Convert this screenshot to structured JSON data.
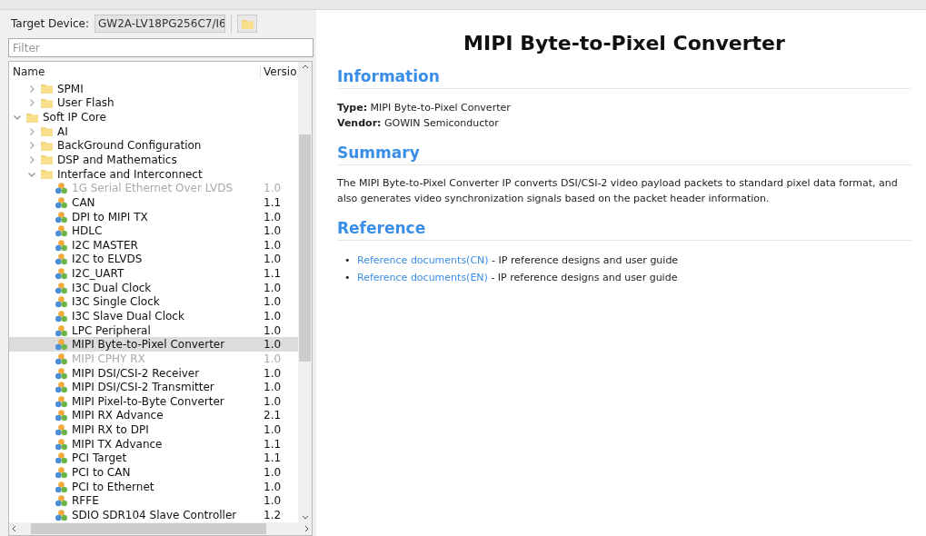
{
  "toolbar": {
    "label": "Target Device:",
    "device": "GW2A-LV18PG256C7/I6"
  },
  "filter": {
    "placeholder": "Filter"
  },
  "tree": {
    "columns": [
      "Name",
      "Versio"
    ],
    "scrolled_group": [
      {
        "kind": "folder",
        "label": "SPMI",
        "expanded": false
      },
      {
        "kind": "folder",
        "label": "User Flash",
        "expanded": false
      }
    ],
    "items": [
      {
        "kind": "folder",
        "label": "Soft IP Core",
        "expanded": true,
        "children": [
          {
            "kind": "folder",
            "label": "AI",
            "expanded": false
          },
          {
            "kind": "folder",
            "label": "BackGround Configuration",
            "expanded": false
          },
          {
            "kind": "folder",
            "label": "DSP and Mathematics",
            "expanded": false
          },
          {
            "kind": "folder",
            "label": "Interface and Interconnect",
            "expanded": true,
            "children": [
              {
                "kind": "ip",
                "label": "1G Serial Ethernet Over LVDS",
                "version": "1.0",
                "disabled": true,
                "selected": false
              },
              {
                "kind": "ip",
                "label": "CAN",
                "version": "1.1",
                "disabled": false,
                "selected": false
              },
              {
                "kind": "ip",
                "label": "DPI to MIPI TX",
                "version": "1.0",
                "disabled": false,
                "selected": false
              },
              {
                "kind": "ip",
                "label": "HDLC",
                "version": "1.0",
                "disabled": false,
                "selected": false
              },
              {
                "kind": "ip",
                "label": "I2C MASTER",
                "version": "1.0",
                "disabled": false,
                "selected": false
              },
              {
                "kind": "ip",
                "label": "I2C to ELVDS",
                "version": "1.0",
                "disabled": false,
                "selected": false
              },
              {
                "kind": "ip",
                "label": "I2C_UART",
                "version": "1.1",
                "disabled": false,
                "selected": false
              },
              {
                "kind": "ip",
                "label": "I3C Dual Clock",
                "version": "1.0",
                "disabled": false,
                "selected": false
              },
              {
                "kind": "ip",
                "label": "I3C Single Clock",
                "version": "1.0",
                "disabled": false,
                "selected": false
              },
              {
                "kind": "ip",
                "label": "I3C Slave Dual Clock",
                "version": "1.0",
                "disabled": false,
                "selected": false
              },
              {
                "kind": "ip",
                "label": "LPC Peripheral",
                "version": "1.0",
                "disabled": false,
                "selected": false
              },
              {
                "kind": "ip",
                "label": "MIPI Byte-to-Pixel Converter",
                "version": "1.0",
                "disabled": false,
                "selected": true
              },
              {
                "kind": "ip",
                "label": "MIPI CPHY RX",
                "version": "1.0",
                "disabled": true,
                "selected": false
              },
              {
                "kind": "ip",
                "label": "MIPI DSI/CSI-2 Receiver",
                "version": "1.0",
                "disabled": false,
                "selected": false
              },
              {
                "kind": "ip",
                "label": "MIPI DSI/CSI-2 Transmitter",
                "version": "1.0",
                "disabled": false,
                "selected": false
              },
              {
                "kind": "ip",
                "label": "MIPI Pixel-to-Byte Converter",
                "version": "1.0",
                "disabled": false,
                "selected": false
              },
              {
                "kind": "ip",
                "label": "MIPI RX Advance",
                "version": "2.1",
                "disabled": false,
                "selected": false
              },
              {
                "kind": "ip",
                "label": "MIPI RX to DPI",
                "version": "1.0",
                "disabled": false,
                "selected": false
              },
              {
                "kind": "ip",
                "label": "MIPI TX Advance",
                "version": "1.1",
                "disabled": false,
                "selected": false
              },
              {
                "kind": "ip",
                "label": "PCI Target",
                "version": "1.1",
                "disabled": false,
                "selected": false
              },
              {
                "kind": "ip",
                "label": "PCI to CAN",
                "version": "1.0",
                "disabled": false,
                "selected": false
              },
              {
                "kind": "ip",
                "label": "PCI to Ethernet",
                "version": "1.0",
                "disabled": false,
                "selected": false
              },
              {
                "kind": "ip",
                "label": "RFFE",
                "version": "1.0",
                "disabled": false,
                "selected": false
              },
              {
                "kind": "ip",
                "label": "SDIO SDR104 Slave Controller",
                "version": "1.2",
                "disabled": false,
                "selected": false
              }
            ]
          }
        ]
      }
    ]
  },
  "doc": {
    "title": "MIPI Byte-to-Pixel Converter",
    "sections": [
      {
        "kind": "fields",
        "heading": "Information",
        "fields": [
          {
            "label": "Type:",
            "value": "MIPI Byte-to-Pixel Converter"
          },
          {
            "label": "Vendor:",
            "value": "GOWIN Semiconductor"
          }
        ]
      },
      {
        "kind": "paragraph",
        "heading": "Summary",
        "text": "The MIPI Byte-to-Pixel Converter IP converts DSI/CSI-2 video payload packets to standard pixel data format, and also generates video synchronization signals based on the packet header information."
      },
      {
        "kind": "links",
        "heading": "Reference",
        "links": [
          {
            "bullet": "•",
            "link": "Reference documents(CN)",
            "text": "- IP reference designs and user guide"
          },
          {
            "bullet": "•",
            "link": "Reference documents(EN)",
            "text": "- IP reference designs and user guide"
          }
        ]
      }
    ]
  }
}
